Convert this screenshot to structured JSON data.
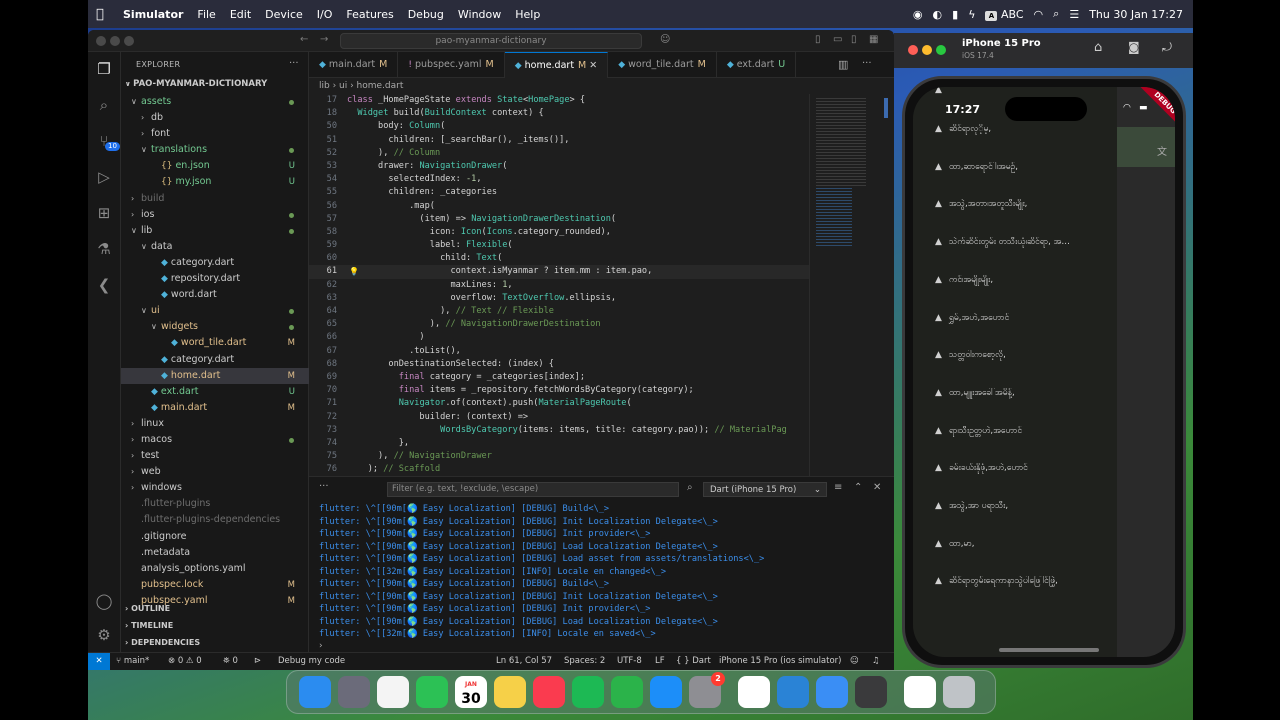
{
  "menubar": {
    "app": "Simulator",
    "items": [
      "File",
      "Edit",
      "Device",
      "I/O",
      "Features",
      "Debug",
      "Window",
      "Help"
    ],
    "input_label": "ABC",
    "clock": "Thu 30 Jan  17:27"
  },
  "vscode": {
    "search_placeholder": "pao-myanmar-dictionary",
    "explorer_title": "EXPLORER",
    "root": "PAO-MYANMAR-DICTIONARY",
    "activity_badge": "10",
    "tree": [
      {
        "name": "assets",
        "kind": "folder-open",
        "depth": 0,
        "color": "#73c991",
        "dot": true
      },
      {
        "name": "db",
        "kind": "folder",
        "depth": 1
      },
      {
        "name": "font",
        "kind": "folder",
        "depth": 1
      },
      {
        "name": "translations",
        "kind": "folder-open",
        "depth": 1,
        "color": "#73c991",
        "dot": true
      },
      {
        "name": "en.json",
        "kind": "json",
        "depth": 2,
        "color": "#73c991",
        "dec": "U"
      },
      {
        "name": "my.json",
        "kind": "json",
        "depth": 2,
        "color": "#73c991",
        "dec": "U"
      },
      {
        "name": "build",
        "kind": "folder",
        "depth": 0,
        "color": "#6e6e6e"
      },
      {
        "name": "ios",
        "kind": "folder",
        "depth": 0,
        "dot": true
      },
      {
        "name": "lib",
        "kind": "folder-open",
        "depth": 0,
        "dot": true
      },
      {
        "name": "data",
        "kind": "folder-open",
        "depth": 1
      },
      {
        "name": "category.dart",
        "kind": "dart",
        "depth": 2
      },
      {
        "name": "repository.dart",
        "kind": "dart",
        "depth": 2
      },
      {
        "name": "word.dart",
        "kind": "dart",
        "depth": 2
      },
      {
        "name": "ui",
        "kind": "folder-open",
        "depth": 1,
        "color": "#e2c08d",
        "dot": true
      },
      {
        "name": "widgets",
        "kind": "folder-open",
        "depth": 2,
        "color": "#e2c08d",
        "dot": true
      },
      {
        "name": "word_tile.dart",
        "kind": "dart",
        "depth": 3,
        "color": "#e2c08d",
        "dec": "M"
      },
      {
        "name": "category.dart",
        "kind": "dart",
        "depth": 2
      },
      {
        "name": "home.dart",
        "kind": "dart",
        "depth": 2,
        "color": "#e2c08d",
        "dec": "M",
        "selected": true
      },
      {
        "name": "ext.dart",
        "kind": "dart",
        "depth": 1,
        "color": "#73c991",
        "dec": "U"
      },
      {
        "name": "main.dart",
        "kind": "dart",
        "depth": 1,
        "color": "#e2c08d",
        "dec": "M"
      },
      {
        "name": "linux",
        "kind": "folder",
        "depth": 0
      },
      {
        "name": "macos",
        "kind": "folder",
        "depth": 0,
        "dot": true
      },
      {
        "name": "test",
        "kind": "folder",
        "depth": 0
      },
      {
        "name": "web",
        "kind": "folder",
        "depth": 0
      },
      {
        "name": "windows",
        "kind": "folder",
        "depth": 0
      },
      {
        "name": ".flutter-plugins",
        "kind": "file",
        "depth": 0,
        "color": "#6e6e6e"
      },
      {
        "name": ".flutter-plugins-dependencies",
        "kind": "file",
        "depth": 0,
        "color": "#6e6e6e"
      },
      {
        "name": ".gitignore",
        "kind": "file",
        "depth": 0
      },
      {
        "name": ".metadata",
        "kind": "file",
        "depth": 0
      },
      {
        "name": "analysis_options.yaml",
        "kind": "file",
        "depth": 0
      },
      {
        "name": "pubspec.lock",
        "kind": "file",
        "depth": 0,
        "color": "#e2c08d",
        "dec": "M"
      },
      {
        "name": "pubspec.yaml",
        "kind": "file",
        "depth": 0,
        "color": "#e2c08d",
        "dec": "M"
      }
    ],
    "sections": [
      "OUTLINE",
      "TIMELINE",
      "DEPENDENCIES"
    ],
    "tabs": [
      {
        "label": "main.dart",
        "dec": "M",
        "dec_kind": "m"
      },
      {
        "label": "pubspec.yaml",
        "dec": "M",
        "dec_kind": "m"
      },
      {
        "label": "home.dart",
        "dec": "M",
        "dec_kind": "m",
        "active": true
      },
      {
        "label": "word_tile.dart",
        "dec": "M",
        "dec_kind": "m"
      },
      {
        "label": "ext.dart",
        "dec": "U",
        "dec_kind": "u"
      }
    ],
    "breadcrumb": "lib › ui › home.dart",
    "code": [
      {
        "n": "17",
        "t": "class _HomePageState extends State<HomePage> {"
      },
      {
        "n": "18",
        "t": "  Widget build(BuildContext context) {"
      },
      {
        "n": "50",
        "t": "      body: Column("
      },
      {
        "n": "51",
        "t": "        children: [_searchBar(), _items()],"
      },
      {
        "n": "52",
        "t": "      ), // Column"
      },
      {
        "n": "53",
        "t": "      drawer: NavigationDrawer("
      },
      {
        "n": "54",
        "t": "        selectedIndex: -1,"
      },
      {
        "n": "55",
        "t": "        children: _categories"
      },
      {
        "n": "56",
        "t": "            .map("
      },
      {
        "n": "57",
        "t": "              (item) => NavigationDrawerDestination("
      },
      {
        "n": "58",
        "t": "                icon: Icon(Icons.category_rounded),"
      },
      {
        "n": "59",
        "t": "                label: Flexible("
      },
      {
        "n": "60",
        "t": "                  child: Text("
      },
      {
        "n": "61",
        "t": "                    context.isMyanmar ? item.mm : item.pao,"
      },
      {
        "n": "62",
        "t": "                    maxLines: 1,"
      },
      {
        "n": "63",
        "t": "                    overflow: TextOverflow.ellipsis,"
      },
      {
        "n": "64",
        "t": "                  ), // Text // Flexible"
      },
      {
        "n": "65",
        "t": "                ), // NavigationDrawerDestination"
      },
      {
        "n": "66",
        "t": "              )"
      },
      {
        "n": "67",
        "t": "            .toList(),"
      },
      {
        "n": "68",
        "t": "        onDestinationSelected: (index) {"
      },
      {
        "n": "69",
        "t": "          final category = _categories[index];"
      },
      {
        "n": "70",
        "t": "          final items = _repository.fetchWordsByCategory(category);"
      },
      {
        "n": "71",
        "t": "          Navigator.of(context).push(MaterialPageRoute("
      },
      {
        "n": "72",
        "t": "              builder: (context) =>"
      },
      {
        "n": "73",
        "t": "                  WordsByCategory(items: items, title: category.pao)); // MaterialPag"
      },
      {
        "n": "74",
        "t": "          },"
      },
      {
        "n": "75",
        "t": "      ), // NavigationDrawer"
      },
      {
        "n": "76",
        "t": "    ); // Scaffold"
      }
    ],
    "current_line": "61",
    "panel": {
      "filter_placeholder": "Filter (e.g. text, !exclude, \\escape)",
      "debug_target": "Dart (iPhone 15 Pro)",
      "console": [
        "flutter: \\^[[90m[🌎 Easy Localization] [DEBUG] Build<\\_>",
        "flutter: \\^[[90m[🌎 Easy Localization] [DEBUG] Init Localization Delegate<\\_>",
        "flutter: \\^[[90m[🌎 Easy Localization] [DEBUG] Init provider<\\_>",
        "flutter: \\^[[90m[🌎 Easy Localization] [DEBUG] Load Localization Delegate<\\_>",
        "flutter: \\^[[90m[🌎 Easy Localization] [DEBUG] Load asset from assets/translations<\\_>",
        "flutter: \\^[[32m[🌎 Easy Localization] [INFO] Locale en changed<\\_>",
        "flutter: \\^[[90m[🌎 Easy Localization] [DEBUG] Build<\\_>",
        "flutter: \\^[[90m[🌎 Easy Localization] [DEBUG] Init Localization Delegate<\\_>",
        "flutter: \\^[[90m[🌎 Easy Localization] [DEBUG] Init provider<\\_>",
        "flutter: \\^[[90m[🌎 Easy Localization] [DEBUG] Load Localization Delegate<\\_>",
        "flutter: \\^[[32m[🌎 Easy Localization] [INFO] Locale en saved<\\_>"
      ]
    },
    "status": {
      "branch": "main*",
      "problems": "⊗ 0 ⚠ 0",
      "ports": "⛯ 0",
      "debug": "Debug my code",
      "position": "Ln 61, Col 57",
      "spaces": "Spaces: 2",
      "encoding": "UTF-8",
      "eol": "LF",
      "language": "{ }  Dart",
      "device": "iPhone 15 Pro (ios simulator)"
    }
  },
  "simulator": {
    "title": "iPhone 15 Pro",
    "subtitle": "iOS 17.4",
    "time": "17:27",
    "debug_banner": "DEBUG",
    "drawer_items": [
      "ဆိင်ရာလုိ့မ့,",
      "ထာ,ဆာရောင်ါ၊အမဉ်,",
      "အသွဲ,အတာ၊အတူသီးမျိုး,",
      "သဲက်ဆိင်းတွမ်း တသီးယုံ၊ဆိင်ရာ, အ…",
      "ကင်၊အမျိုးမျိုး,",
      "ရွှမ်,အဟဲ,အဟောင်",
      "သတ္တဝါးကစော့လို,",
      "ထာ,မျူးအခေါ်အမိန့်,",
      "ရာ၊သီးဥတ္တဟဲ,အဟောင်",
      "ခမ်းခယ်းနိုဖုံ,အဟဲ,ဟောင်",
      "အသွဲ,အာ ပရာသီး,",
      "ထာ,မာ,",
      "ဆိင်ရာတွမ်းရေကာနာသွဲပါဖြေါင်ဖြဲ့,"
    ]
  },
  "dock": {
    "calendar_month": "JAN",
    "calendar_day": "30",
    "settings_badge": "2",
    "apps": [
      "finder-icon",
      "launchpad-icon",
      "photos-icon",
      "facetime-icon",
      "calendar-icon",
      "notes-icon",
      "music-icon",
      "spotify-icon",
      "numbers-icon",
      "appstore-icon",
      "settings-icon",
      "chrome-icon",
      "vscode-icon",
      "xcode-icon",
      "quicktime-icon",
      "document-icon",
      "trash-icon"
    ]
  }
}
